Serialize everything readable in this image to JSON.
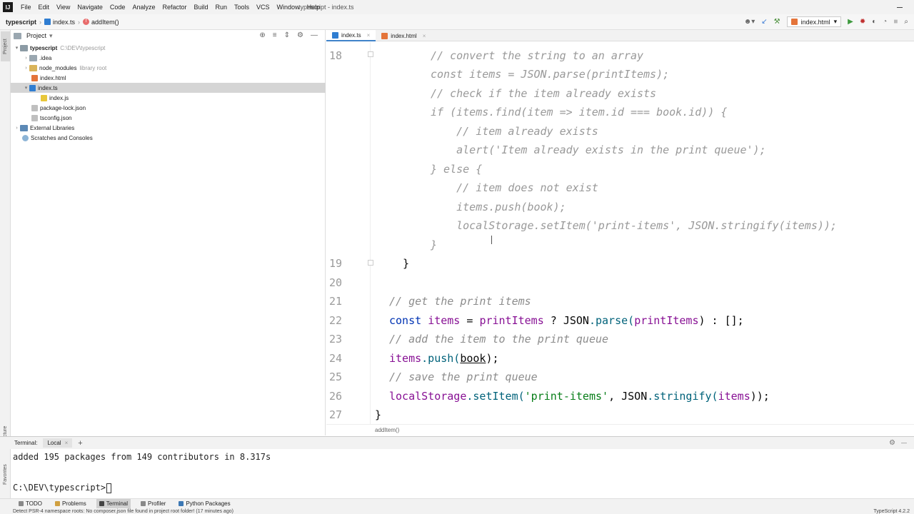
{
  "menu": {
    "items": [
      "File",
      "Edit",
      "View",
      "Navigate",
      "Code",
      "Analyze",
      "Refactor",
      "Build",
      "Run",
      "Tools",
      "VCS",
      "Window",
      "Help"
    ],
    "window_title": "typescript - index.ts"
  },
  "nav": {
    "project": "typescript",
    "file": "index.ts",
    "function": "addItem()",
    "run_config": "index.html"
  },
  "left_strip": {
    "project": "Project",
    "structure": "Structure",
    "favorites": "Favorites"
  },
  "project_panel": {
    "title": "Project",
    "tree": [
      {
        "label": "typescript",
        "extra": "C:\\DEV\\typescript",
        "icon": "folder-icon"
      },
      {
        "label": ".idea",
        "extra": "",
        "icon": "folder-icon"
      },
      {
        "label": "node_modules",
        "extra": "library root",
        "icon": "folder-icon"
      },
      {
        "label": "index.html",
        "extra": "",
        "icon": "html-file-icon"
      },
      {
        "label": "index.ts",
        "extra": "",
        "icon": "ts-file-icon"
      },
      {
        "label": "index.js",
        "extra": "",
        "icon": "js-file-icon"
      },
      {
        "label": "package-lock.json",
        "extra": "",
        "icon": "json-file-icon"
      },
      {
        "label": "tsconfig.json",
        "extra": "",
        "icon": "json-file-icon"
      },
      {
        "label": "External Libraries",
        "extra": "",
        "icon": "library-icon"
      },
      {
        "label": "Scratches and Consoles",
        "extra": "",
        "icon": "scratch-icon"
      }
    ]
  },
  "editor_tabs": [
    {
      "label": "index.ts",
      "active": true
    },
    {
      "label": "index.html",
      "active": false
    }
  ],
  "editor": {
    "line_numbers": [
      "18",
      "19",
      "20",
      "21",
      "22",
      "23",
      "24",
      "25",
      "26",
      "27"
    ],
    "inlay": [
      "// convert the string to an array",
      "const items = JSON.parse(printItems);",
      "// check if the item already exists",
      "if (items.find(item => item.id === book.id)) {",
      "    // item already exists",
      "    alert('Item already exists in the print queue');",
      "} else {",
      "    // item does not exist",
      "    items.push(book);",
      "    localStorage.setItem('print-items', JSON.stringify(items));",
      "}"
    ],
    "line19": "}",
    "line21": "// get the print items",
    "line22": {
      "kw": "const",
      "var": "items",
      "eq": " = ",
      "id": "printItems",
      "q": " ? ",
      "json": "JSON",
      "fn": ".parse(",
      "arg": "printItems",
      "end": ") : [];"
    },
    "line23": "// add the item to the print queue",
    "line24": {
      "var": "items",
      "fn": ".push(",
      "arg": "book",
      "end": ");"
    },
    "line25": "// save the print queue",
    "line26": {
      "obj": "localStorage",
      "fn": ".setItem(",
      "str": "'print-items'",
      "sep": ", ",
      "json": "JSON",
      "fn2": ".stringify(",
      "arg": "items",
      "end": "));"
    },
    "line27": "}",
    "breadcrumb": "addItem()"
  },
  "terminal": {
    "label": "Terminal:",
    "tab": "Local",
    "add": "+",
    "output": "added 195 packages from 149 contributors in 8.317s",
    "prompt": "C:\\DEV\\typescript>"
  },
  "bottom_tools": [
    "TODO",
    "Problems",
    "Terminal",
    "Profiler",
    "Python Packages"
  ],
  "status": {
    "message": "Detect PSR-4 namespace roots: No composer.json file found in project root folder! (17 minutes ago)",
    "right": "TypeScript 4.2.2"
  }
}
